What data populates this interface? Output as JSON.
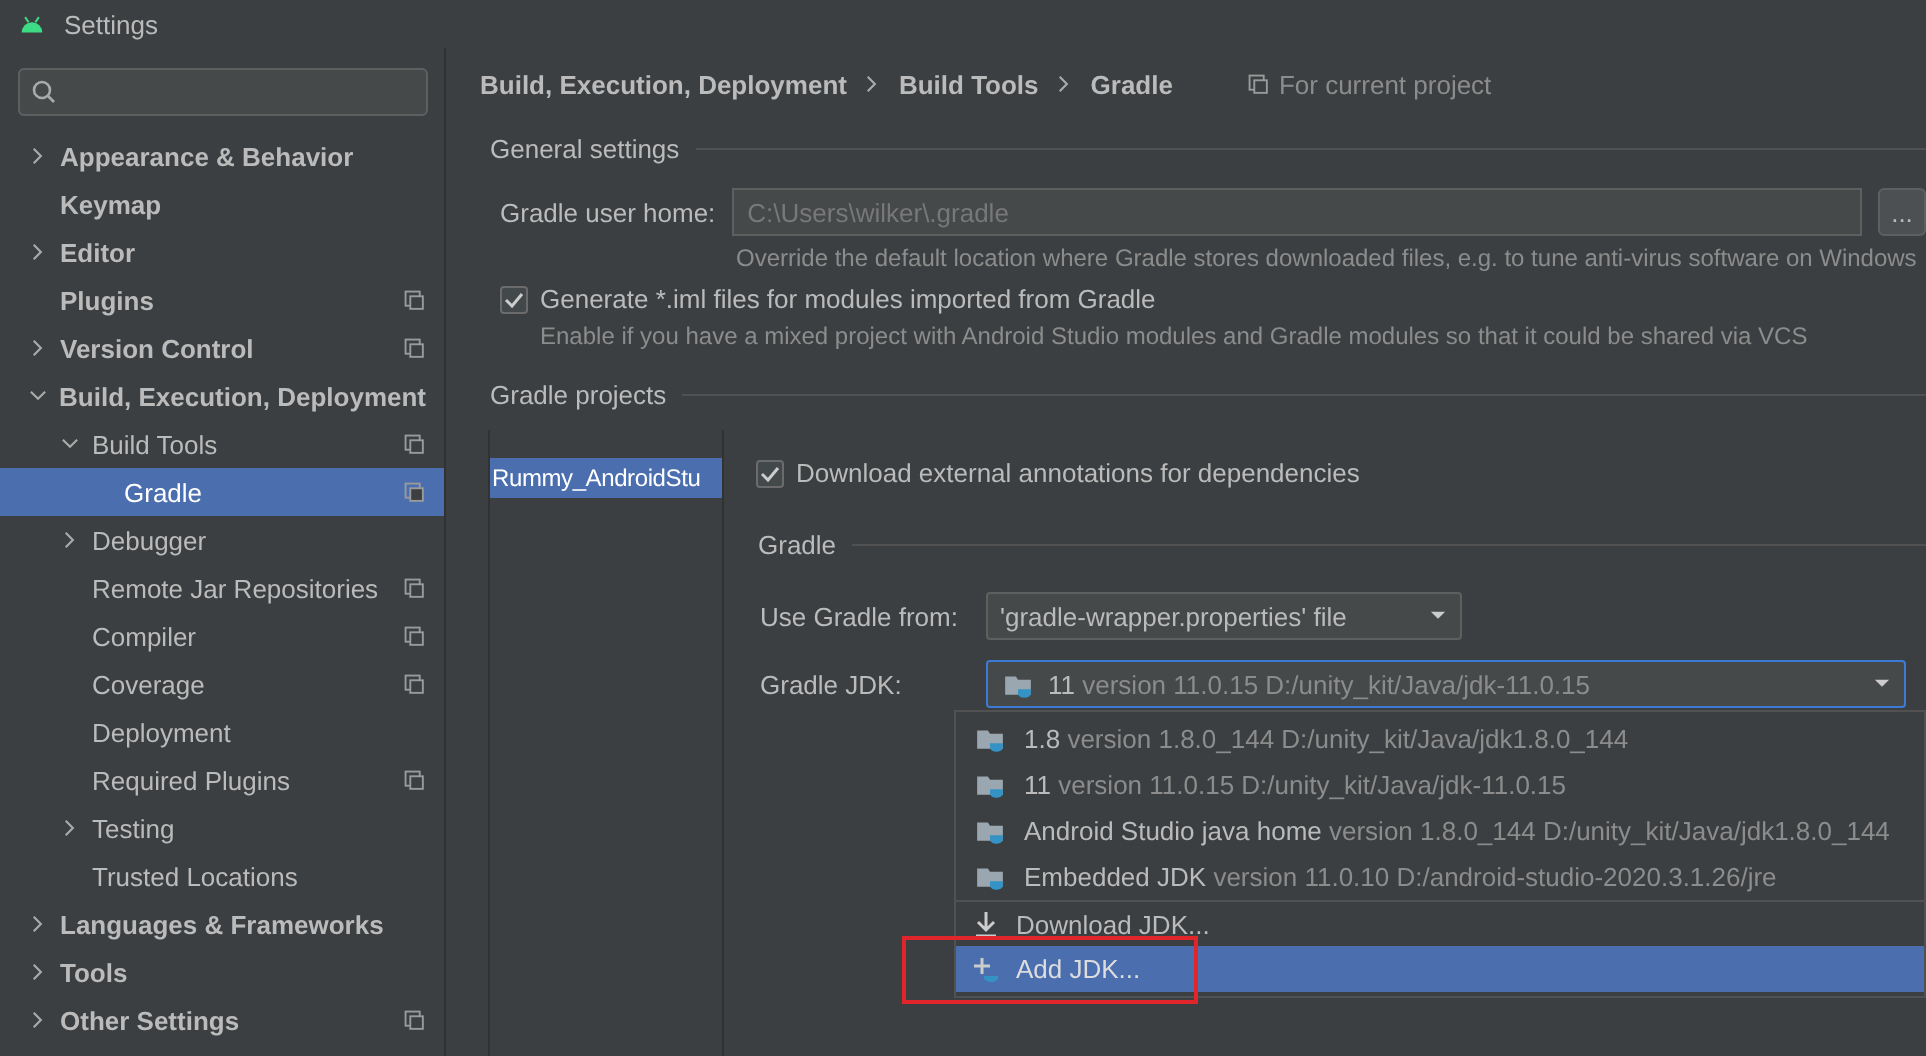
{
  "window": {
    "title": "Settings"
  },
  "sidebar": {
    "items": [
      {
        "label": "Appearance & Behavior",
        "expanded": false,
        "selected": false,
        "project_level": false
      },
      {
        "label": "Keymap",
        "selected": false,
        "project_level": false
      },
      {
        "label": "Editor",
        "expanded": false,
        "selected": false,
        "project_level": false
      },
      {
        "label": "Plugins",
        "selected": false,
        "project_level": true
      },
      {
        "label": "Version Control",
        "expanded": false,
        "selected": false,
        "project_level": true
      },
      {
        "label": "Build, Execution, Deployment",
        "expanded": true,
        "selected": false,
        "project_level": false,
        "children": [
          {
            "label": "Build Tools",
            "expanded": true,
            "selected": false,
            "project_level": true,
            "children": [
              {
                "label": "Gradle",
                "selected": true,
                "project_level": true
              }
            ]
          },
          {
            "label": "Debugger",
            "expanded": false,
            "selected": false,
            "project_level": false
          },
          {
            "label": "Remote Jar Repositories",
            "selected": false,
            "project_level": true
          },
          {
            "label": "Compiler",
            "selected": false,
            "project_level": true
          },
          {
            "label": "Coverage",
            "selected": false,
            "project_level": true
          },
          {
            "label": "Deployment",
            "selected": false,
            "project_level": false
          },
          {
            "label": "Required Plugins",
            "selected": false,
            "project_level": true
          },
          {
            "label": "Testing",
            "expanded": false,
            "selected": false,
            "project_level": false
          },
          {
            "label": "Trusted Locations",
            "selected": false,
            "project_level": false
          }
        ]
      },
      {
        "label": "Languages & Frameworks",
        "expanded": false,
        "selected": false,
        "project_level": false
      },
      {
        "label": "Tools",
        "expanded": false,
        "selected": false,
        "project_level": false
      },
      {
        "label": "Other Settings",
        "expanded": false,
        "selected": false,
        "project_level": true
      }
    ]
  },
  "breadcrumb": [
    "Build, Execution, Deployment",
    "Build Tools",
    "Gradle"
  ],
  "scope": "For current project",
  "general_settings": {
    "title": "General settings",
    "user_home": {
      "label": "Gradle user home:",
      "value": "C:\\Users\\wilker\\.gradle",
      "browse": "...",
      "hint": "Override the default location where Gradle stores downloaded files, e.g. to tune anti-virus software on Windows"
    },
    "generate_iml": {
      "label": "Generate *.iml files for modules imported from Gradle",
      "checked": true,
      "hint": "Enable if you have a mixed project with Android Studio modules and Gradle modules so that it could be shared via VCS"
    }
  },
  "gradle_projects": {
    "title": "Gradle projects",
    "projects": [
      {
        "label": "Rummy_AndroidStu",
        "selected": true
      }
    ],
    "download_annotations": {
      "label": "Download external annotations for dependencies",
      "checked": true
    },
    "gradle_section": "Gradle",
    "use_gradle_from": {
      "label": "Use Gradle from:",
      "value": "'gradle-wrapper.properties' file"
    },
    "gradle_jdk": {
      "label": "Gradle JDK:",
      "name": "11",
      "detail": "version 11.0.15 D:/unity_kit/Java/jdk-11.0.15",
      "expanded": true
    },
    "jdk_options": [
      {
        "kind": "jdk",
        "name": "1.8",
        "detail": "version 1.8.0_144 D:/unity_kit/Java/jdk1.8.0_144",
        "selected": false
      },
      {
        "kind": "jdk",
        "name": "11",
        "detail": "version 11.0.15 D:/unity_kit/Java/jdk-11.0.15",
        "selected": false
      },
      {
        "kind": "jdk",
        "name": "Android Studio java home",
        "detail": "version 1.8.0_144 D:/unity_kit/Java/jdk1.8.0_144",
        "selected": false
      },
      {
        "kind": "jdk",
        "name": "Embedded JDK",
        "detail": "version 11.0.10 D:/android-studio-2020.3.1.26/jre",
        "selected": false
      },
      {
        "kind": "download",
        "name": "Download JDK...",
        "selected": false
      },
      {
        "kind": "add",
        "name": "Add JDK...",
        "selected": true,
        "highlighted": true
      }
    ]
  }
}
